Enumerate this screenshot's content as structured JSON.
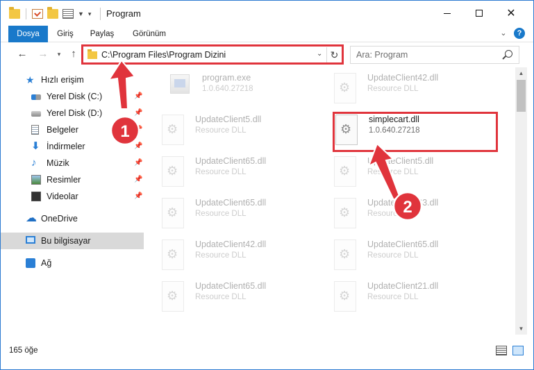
{
  "window": {
    "title": "Program"
  },
  "ribbon": {
    "tabs": [
      {
        "label": "Dosya"
      },
      {
        "label": "Giriş"
      },
      {
        "label": "Paylaş"
      },
      {
        "label": "Görünüm"
      }
    ],
    "help_label": "?"
  },
  "address": {
    "path": "C:\\Program Files\\Program Dizini"
  },
  "search": {
    "placeholder": "Ara: Program"
  },
  "sidebar": {
    "items": [
      {
        "label": "Hızlı erişim"
      },
      {
        "label": "Yerel Disk (C:)"
      },
      {
        "label": "Yerel Disk (D:)"
      },
      {
        "label": "Belgeler"
      },
      {
        "label": "İndirmeler"
      },
      {
        "label": "Müzik"
      },
      {
        "label": "Resimler"
      },
      {
        "label": "Videolar"
      },
      {
        "label": "OneDrive"
      },
      {
        "label": "Bu bilgisayar"
      },
      {
        "label": "Ağ"
      }
    ]
  },
  "files": [
    {
      "name": "program.exe",
      "type": "1.0.640.27218"
    },
    {
      "name": "UpdateClient42.dll",
      "type": "Resource DLL"
    },
    {
      "name": "UpdateClient5.dll",
      "type": "Resource DLL"
    },
    {
      "name": "simplecart.dll",
      "type": "1.0.640.27218"
    },
    {
      "name": "UpdateClient65.dll",
      "type": "Resource DLL"
    },
    {
      "name": "UpdateClient5.dll",
      "type": "Resource DLL"
    },
    {
      "name": "UpdateClient65.dll",
      "type": "Resource DLL"
    },
    {
      "name": "UpdateClient63.dll",
      "type": "Resource DLL"
    },
    {
      "name": "UpdateClient42.dll",
      "type": "Resource DLL"
    },
    {
      "name": "UpdateClient65.dll",
      "type": "Resource DLL"
    },
    {
      "name": "UpdateClient65.dll",
      "type": "Resource DLL"
    },
    {
      "name": "UpdateClient21.dll",
      "type": "Resource DLL"
    }
  ],
  "status": {
    "item_count": "165 öğe"
  },
  "annotations": {
    "callout_1": "1",
    "callout_2": "2",
    "accent_color": "#e0343c"
  }
}
